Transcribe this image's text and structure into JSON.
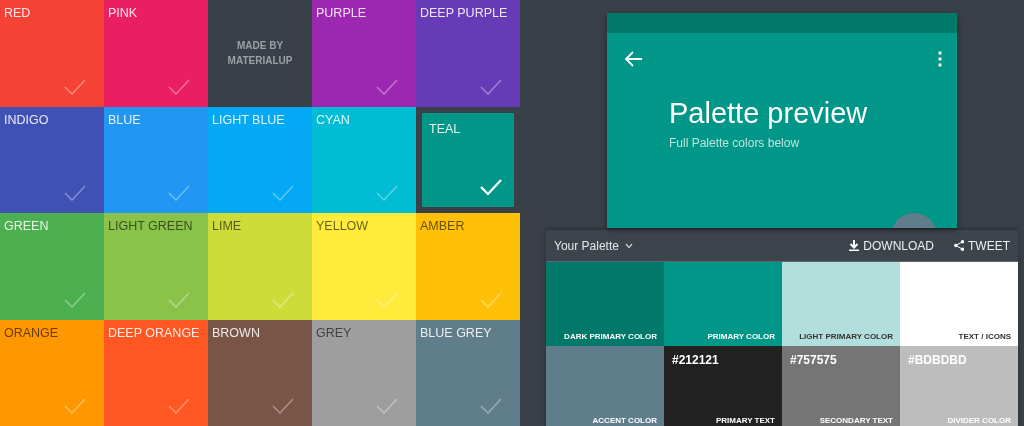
{
  "color_grid": [
    {
      "kind": "color",
      "label": "RED",
      "color": "#f44336",
      "selected": false
    },
    {
      "kind": "color",
      "label": "PINK",
      "color": "#e91e63",
      "selected": false
    },
    {
      "kind": "credit",
      "label": "MADE BY MATERIALUP"
    },
    {
      "kind": "color",
      "label": "PURPLE",
      "color": "#9c27b0",
      "selected": false
    },
    {
      "kind": "color",
      "label": "DEEP PURPLE",
      "color": "#673ab7",
      "selected": false
    },
    {
      "kind": "color",
      "label": "INDIGO",
      "color": "#3f51b5",
      "selected": false
    },
    {
      "kind": "color",
      "label": "BLUE",
      "color": "#2196f3",
      "selected": false
    },
    {
      "kind": "color",
      "label": "LIGHT BLUE",
      "color": "#03a9f4",
      "selected": false
    },
    {
      "kind": "color",
      "label": "CYAN",
      "color": "#00bcd4",
      "selected": false
    },
    {
      "kind": "color",
      "label": "TEAL",
      "color": "#009688",
      "selected": true
    },
    {
      "kind": "color",
      "label": "GREEN",
      "color": "#4caf50",
      "selected": false
    },
    {
      "kind": "color",
      "label": "LIGHT GREEN",
      "color": "#8bc34a",
      "selected": false
    },
    {
      "kind": "color",
      "label": "LIME",
      "color": "#cddc39",
      "selected": false
    },
    {
      "kind": "color",
      "label": "YELLOW",
      "color": "#ffeb3b",
      "selected": false
    },
    {
      "kind": "color",
      "label": "AMBER",
      "color": "#ffc107",
      "selected": false
    },
    {
      "kind": "color",
      "label": "ORANGE",
      "color": "#ff9800",
      "selected": false
    },
    {
      "kind": "color",
      "label": "DEEP ORANGE",
      "color": "#ff5722",
      "selected": false
    },
    {
      "kind": "color",
      "label": "BROWN",
      "color": "#795548",
      "selected": false
    },
    {
      "kind": "color",
      "label": "GREY",
      "color": "#9e9e9e",
      "selected": false
    },
    {
      "kind": "color",
      "label": "BLUE GREY",
      "color": "#607d8b",
      "selected": false
    }
  ],
  "preview": {
    "color": "#009688",
    "status_bar": {
      "color": "#00796b"
    },
    "title": "Palette preview",
    "subtitle": "Full Palette colors below",
    "fab": {
      "color": "#607d8b"
    }
  },
  "palette_panel": {
    "title": "Your Palette",
    "actions": [
      "DOWNLOAD",
      "TWEET"
    ],
    "swatches": [
      {
        "label": "DARK PRIMARY COLOR",
        "color": "#00796b"
      },
      {
        "label": "PRIMARY COLOR",
        "color": "#009688"
      },
      {
        "label": "LIGHT PRIMARY COLOR",
        "color": "#b2dfdb"
      },
      {
        "label": "TEXT / ICONS",
        "color": "#ffffff"
      },
      {
        "label": "ACCENT COLOR",
        "color": "#607d8b"
      },
      {
        "label": "PRIMARY TEXT",
        "hex": "#212121",
        "color": "#212121"
      },
      {
        "label": "SECONDARY TEXT",
        "hex": "#757575",
        "color": "#757575"
      },
      {
        "label": "DIVIDER COLOR",
        "hex": "#BDBDBD",
        "color": "#bdbdbd"
      }
    ]
  }
}
